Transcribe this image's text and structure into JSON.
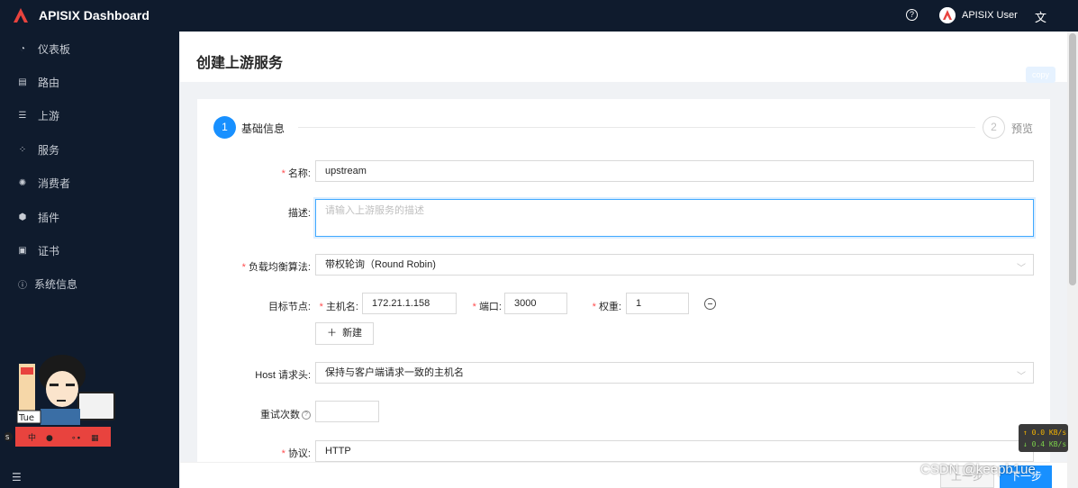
{
  "app": {
    "title": "APISIX Dashboard",
    "help_icon": "question-circle-icon",
    "user_name": "APISIX User",
    "lang_icon": "translate-icon",
    "accent": "#1890ff",
    "header_bg": "#0f1b2d",
    "logo_color": "#e8433e"
  },
  "sidebar": {
    "items": [
      {
        "icon": "dashboard-icon",
        "label": "仪表板"
      },
      {
        "icon": "route-icon",
        "label": "路由"
      },
      {
        "icon": "upstream-icon",
        "label": "上游"
      },
      {
        "icon": "service-icon",
        "label": "服务"
      },
      {
        "icon": "consumer-icon",
        "label": "消费者"
      },
      {
        "icon": "plugin-icon",
        "label": "插件"
      },
      {
        "icon": "certificate-icon",
        "label": "证书"
      },
      {
        "icon": "info-circle-icon",
        "label": "系统信息"
      }
    ],
    "collapse_icon": "menu-fold-icon",
    "sticker_text": "Tue"
  },
  "page": {
    "title": "创建上游服务",
    "copy_label": "copy"
  },
  "steps": [
    {
      "number": "1",
      "label": "基础信息",
      "state": "active"
    },
    {
      "number": "2",
      "label": "预览",
      "state": "wait"
    }
  ],
  "form": {
    "name": {
      "label": "名称:",
      "value": "upstream",
      "required": true
    },
    "desc": {
      "label": "描述:",
      "placeholder": "请输入上游服务的描述"
    },
    "algorithm": {
      "label": "负载均衡算法:",
      "value": "带权轮询（Round Robin)",
      "required": true
    },
    "nodes": {
      "label": "目标节点:",
      "host_label": "主机名:",
      "host_value": "172.21.1.158",
      "port_label": "端口:",
      "port_value": "3000",
      "weight_label": "权重:",
      "weight_value": "1",
      "add_label": "新建"
    },
    "host_header": {
      "label": "Host 请求头:",
      "value": "保持与客户端请求一致的主机名"
    },
    "retries": {
      "label": "重试次数",
      "value": ""
    },
    "protocol": {
      "label": "协议:",
      "value": "HTTP",
      "required": true
    }
  },
  "footer": {
    "prev_label": "上一步",
    "next_label": "下一步"
  },
  "overlay": {
    "net_up": "0.0 KB/s",
    "net_down": "0.4 KB/s",
    "watermark": "CSDN @keepb1ue"
  }
}
